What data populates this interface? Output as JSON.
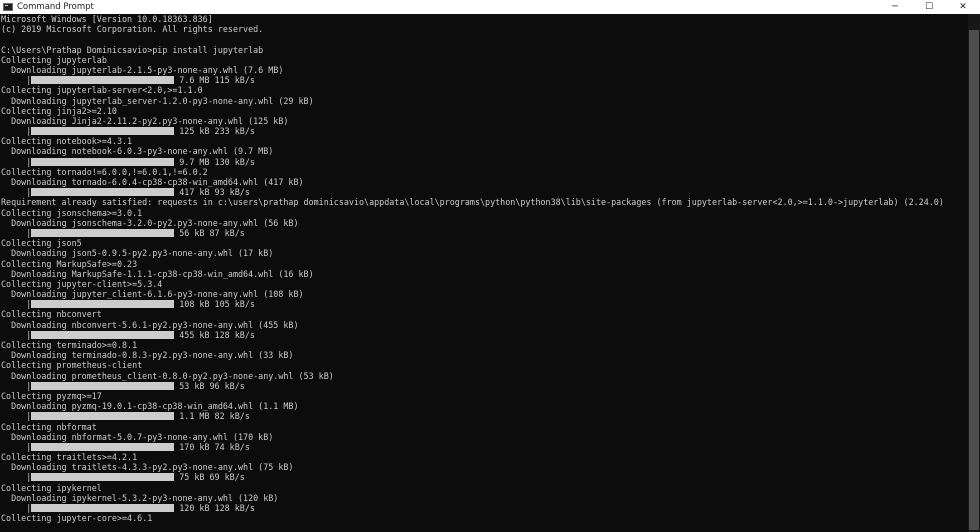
{
  "window": {
    "title": "Command Prompt",
    "minimize_glyph": "─",
    "maximize_glyph": "☐",
    "close_glyph": "✕"
  },
  "console": {
    "lines": [
      {
        "text": "Microsoft Windows [Version 10.0.18363.836]"
      },
      {
        "text": "(c) 2019 Microsoft Corporation. All rights reserved."
      },
      {
        "text": ""
      },
      {
        "text": "C:\\Users\\Prathap Dominicsavio>pip install jupyterlab"
      },
      {
        "text": "Collecting jupyterlab"
      },
      {
        "text": "  Downloading jupyterlab-2.1.5-py3-none-any.whl (7.6 MB)"
      },
      {
        "bar": true,
        "indent": "     |",
        "text": "7.6 MB 115 kB/s"
      },
      {
        "text": "Collecting jupyterlab-server<2.0,>=1.1.0"
      },
      {
        "text": "  Downloading jupyterlab_server-1.2.0-py3-none-any.whl (29 kB)"
      },
      {
        "text": "Collecting jinja2>=2.10"
      },
      {
        "text": "  Downloading Jinja2-2.11.2-py2.py3-none-any.whl (125 kB)"
      },
      {
        "bar": true,
        "indent": "     |",
        "text": "125 kB 233 kB/s"
      },
      {
        "text": "Collecting notebook>=4.3.1"
      },
      {
        "text": "  Downloading notebook-6.0.3-py3-none-any.whl (9.7 MB)"
      },
      {
        "bar": true,
        "indent": "     |",
        "text": "9.7 MB 130 kB/s"
      },
      {
        "text": "Collecting tornado!=6.0.0,!=6.0.1,!=6.0.2"
      },
      {
        "text": "  Downloading tornado-6.0.4-cp38-cp38-win_amd64.whl (417 kB)"
      },
      {
        "bar": true,
        "indent": "     |",
        "text": "417 kB 93 kB/s"
      },
      {
        "text": "Requirement already satisfied: requests in c:\\users\\prathap dominicsavio\\appdata\\local\\programs\\python\\python38\\lib\\site-packages (from jupyterlab-server<2.0,>=1.1.0->jupyterlab) (2.24.0)"
      },
      {
        "text": "Collecting jsonschema>=3.0.1"
      },
      {
        "text": "  Downloading jsonschema-3.2.0-py2.py3-none-any.whl (56 kB)"
      },
      {
        "bar": true,
        "indent": "     |",
        "text": "56 kB 87 kB/s"
      },
      {
        "text": "Collecting json5"
      },
      {
        "text": "  Downloading json5-0.9.5-py2.py3-none-any.whl (17 kB)"
      },
      {
        "text": "Collecting MarkupSafe>=0.23"
      },
      {
        "text": "  Downloading MarkupSafe-1.1.1-cp38-cp38-win_amd64.whl (16 kB)"
      },
      {
        "text": "Collecting jupyter-client>=5.3.4"
      },
      {
        "text": "  Downloading jupyter_client-6.1.6-py3-none-any.whl (108 kB)"
      },
      {
        "bar": true,
        "indent": "     |",
        "text": "108 kB 105 kB/s"
      },
      {
        "text": "Collecting nbconvert"
      },
      {
        "text": "  Downloading nbconvert-5.6.1-py2.py3-none-any.whl (455 kB)"
      },
      {
        "bar": true,
        "indent": "     |",
        "text": "455 kB 128 kB/s"
      },
      {
        "text": "Collecting terminado>=0.8.1"
      },
      {
        "text": "  Downloading terminado-0.8.3-py2.py3-none-any.whl (33 kB)"
      },
      {
        "text": "Collecting prometheus-client"
      },
      {
        "text": "  Downloading prometheus_client-0.8.0-py2.py3-none-any.whl (53 kB)"
      },
      {
        "bar": true,
        "indent": "     |",
        "text": "53 kB 96 kB/s"
      },
      {
        "text": "Collecting pyzmq>=17"
      },
      {
        "text": "  Downloading pyzmq-19.0.1-cp38-cp38-win_amd64.whl (1.1 MB)"
      },
      {
        "bar": true,
        "indent": "     |",
        "text": "1.1 MB 82 kB/s"
      },
      {
        "text": "Collecting nbformat"
      },
      {
        "text": "  Downloading nbformat-5.0.7-py3-none-any.whl (170 kB)"
      },
      {
        "bar": true,
        "indent": "     |",
        "text": "170 kB 74 kB/s"
      },
      {
        "text": "Collecting traitlets>=4.2.1"
      },
      {
        "text": "  Downloading traitlets-4.3.3-py2.py3-none-any.whl (75 kB)"
      },
      {
        "bar": true,
        "indent": "     |",
        "text": "75 kB 69 kB/s"
      },
      {
        "text": "Collecting ipykernel"
      },
      {
        "text": "  Downloading ipykernel-5.3.2-py3-none-any.whl (120 kB)"
      },
      {
        "bar": true,
        "indent": "     |",
        "text": "120 kB 128 kB/s"
      },
      {
        "text": "Collecting jupyter-core>=4.6.1"
      }
    ]
  }
}
